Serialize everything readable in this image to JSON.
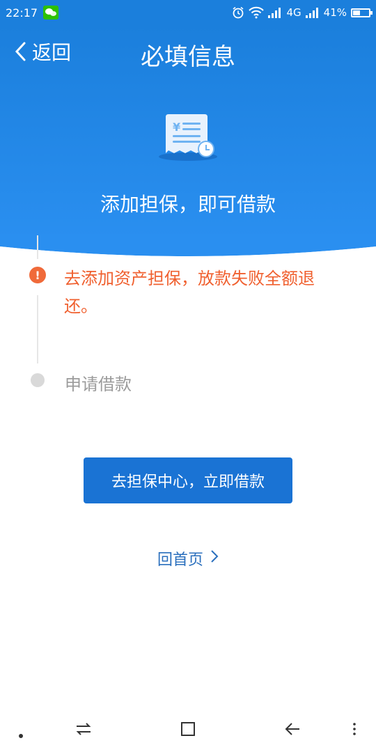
{
  "status_bar": {
    "time": "22:17",
    "network": "4G",
    "battery_percent": "41%",
    "battery_level": 0.41
  },
  "nav": {
    "back_label": "返回",
    "title": "必填信息"
  },
  "header": {
    "icon": "receipt-yen-icon",
    "message": "添加担保，即可借款"
  },
  "steps": [
    {
      "text": "去添加资产担保，放款失败全额退还。",
      "state": "warning"
    },
    {
      "text": "申请借款",
      "state": "pending"
    }
  ],
  "actions": {
    "primary_label": "去担保中心，立即借款",
    "home_label": "回首页"
  },
  "colors": {
    "brand_blue": "#1b7fdc",
    "button_blue": "#1a73d4",
    "warning_orange": "#f0602f",
    "link_blue": "#2a6fbd"
  }
}
